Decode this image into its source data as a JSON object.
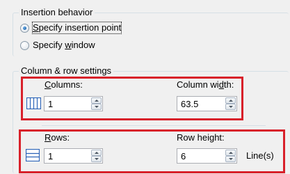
{
  "insertion": {
    "title": "Insertion behavior",
    "option1": {
      "prefix": "",
      "accel": "S",
      "suffix": "pecify insertion point",
      "selected": true
    },
    "option2": {
      "prefix": "Specify ",
      "accel": "w",
      "suffix": "indow",
      "selected": false
    }
  },
  "colrow": {
    "title": "Column & row settings",
    "columns": {
      "label_accel": "C",
      "label_rest": "olumns:",
      "value": "1",
      "width_label_prefix": "Column wi",
      "width_label_accel": "d",
      "width_label_suffix": "th:",
      "width_value": "63.5",
      "icon": "columns-icon"
    },
    "rows": {
      "label_accel": "R",
      "label_rest": "ows:",
      "value": "1",
      "height_label": "Row height:",
      "height_value": "6",
      "unit": "Line(s)",
      "icon": "rows-icon"
    }
  },
  "colors": {
    "highlight_frame": "#d8202a",
    "icon_blue": "#2b63b8",
    "groupbox_border": "#d5dfe5"
  }
}
